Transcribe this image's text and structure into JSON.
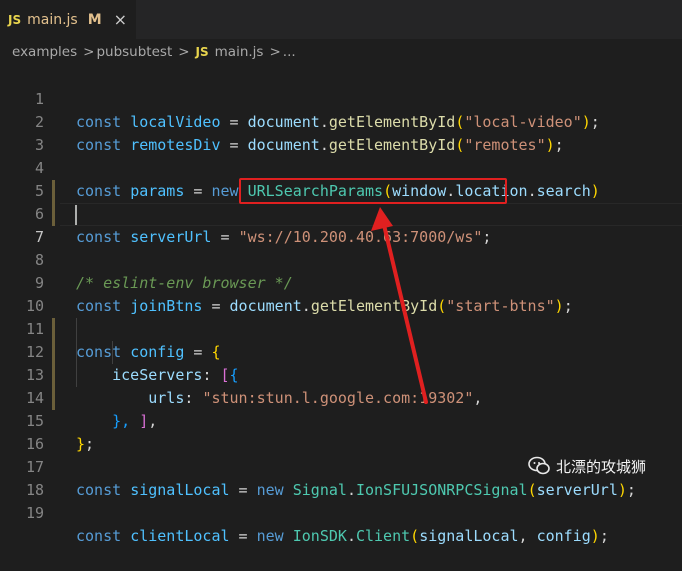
{
  "tab": {
    "icon_text": "JS",
    "name": "main.js",
    "badge": "M",
    "close": "×"
  },
  "breadcrumb": {
    "items": [
      "examples",
      "pubsubtest"
    ],
    "separator": ">",
    "file_icon_text": "JS",
    "file": "main.js",
    "trailing": "..."
  },
  "lines": {
    "n1": "1",
    "n2": "2",
    "n3": "3",
    "n4": "4",
    "n5": "5",
    "n6": "6",
    "n7": "7",
    "n8": "8",
    "n9": "9",
    "n10": "10",
    "n11": "11",
    "n12": "12",
    "n13": "13",
    "n14": "14",
    "n15": "15",
    "n16": "16",
    "n17": "17",
    "n18": "18",
    "n19": "19"
  },
  "code": {
    "const": "const",
    "new": "new",
    "eq": " = ",
    "semi": ";",
    "localVideo": "localVideo",
    "remotesDiv": "remotesDiv",
    "document": "document",
    "dot": ".",
    "getElementById": "getElementById",
    "lp": "(",
    "rp": ")",
    "str_local_video": "\"local-video\"",
    "str_remotes": "\"remotes\"",
    "params": "params",
    "URLSearchParams": "URLSearchParams",
    "window": "window",
    "location": "location",
    "search": "search",
    "serverUrl": "serverUrl",
    "str_server": "\"ws://10.200.40.63:7000/ws\"",
    "comment": "/* eslint-env browser */",
    "joinBtns": "joinBtns",
    "str_start_btns": "\"start-btns\"",
    "config": "config",
    "lbrace": "{",
    "iceServers": "iceServers",
    "colon": ": ",
    "lbracket": "[",
    "urls": "urls",
    "str_stun": "\"stun:stun.l.google.com:19302\"",
    "comma": ",",
    "rbrace_comma": "}, ",
    "rbracket": "]",
    "close_obj": "}",
    "signalLocal": "signalLocal",
    "Signal": "Signal",
    "IonSFUJSONRPCSignal": "IonSFUJSONRPCSignal",
    "clientLocal": "clientLocal",
    "IonSDK": "IonSDK",
    "Client": "Client",
    "comma_space": ", "
  },
  "watermark": {
    "logo": "wechat-logo",
    "text": "北漂的攻城狮"
  },
  "colors": {
    "annotation": "#e02020",
    "background": "#1e1e1e"
  }
}
